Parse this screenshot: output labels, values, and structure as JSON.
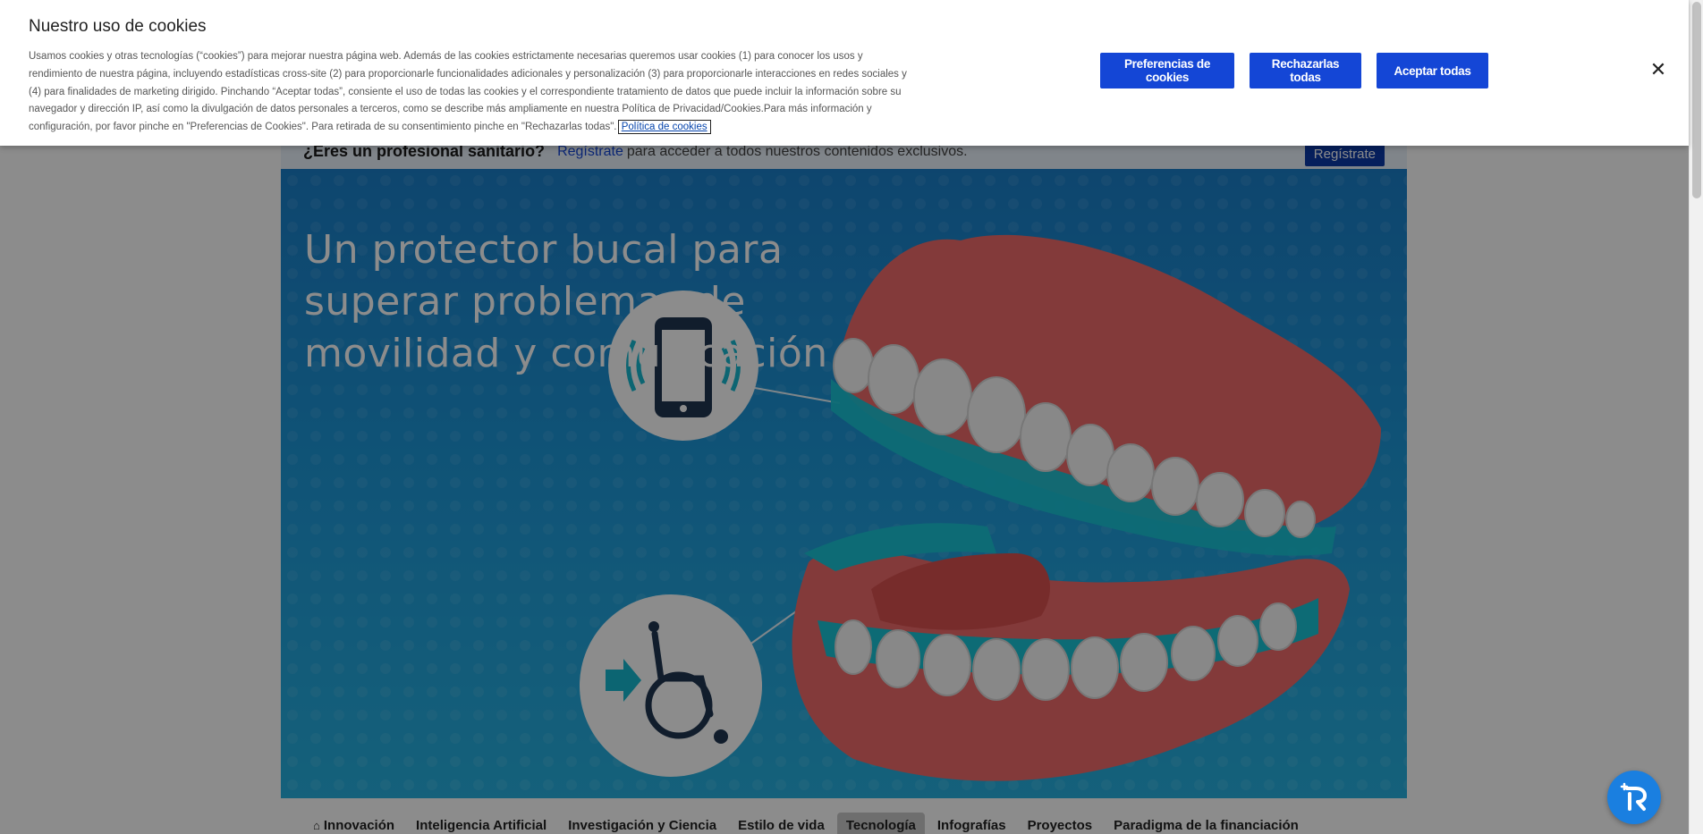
{
  "cookie_banner": {
    "title": "Nuestro uso de cookies",
    "text": "Usamos cookies y otras tecnologías (“cookies”) para mejorar nuestra página web. Además de las cookies estrictamente necesarias queremos usar cookies (1) para conocer los usos y rendimiento de nuestra página, incluyendo estadísticas cross-site (2) para proporcionarle funcionalidades adicionales y personalización (3) para proporcionarle interacciones en redes sociales y (4) para finalidades de marketing dirigido. Pinchando “Aceptar todas”, consiente el uso de todas las cookies y el correspondiente tratamiento de datos que puede incluir la información sobre su navegador y dirección IP, así como la divulgación de datos personales a terceros, como se describe más ampliamente en nuestra Política de Privacidad/Cookies.Para más información y configuración, por favor pinche en \"Preferencias de Cookies\". Para retirada de su consentimiento pinche en \"Rechazarlas todas\".",
    "policy_link": "Política de cookies",
    "buttons": {
      "preferences": "Preferencias de cookies",
      "reject": "Rechazarlas todas",
      "accept": "Aceptar todas"
    },
    "close_icon": "close-icon",
    "accent_color": "#1446d6"
  },
  "pro_banner": {
    "question": "¿Eres un profesional sanitario?",
    "link": "Regístrate",
    "rest": "para acceder a todos nuestros contenidos exclusivos.",
    "button": "Regístrate"
  },
  "hero": {
    "title": "Un protector bucal para superar problemas de movilidad y comunicación"
  },
  "category_nav": {
    "home_icon": "home-icon",
    "items": [
      {
        "label": "Innovación",
        "active": false
      },
      {
        "label": "Inteligencia Artificial",
        "active": false
      },
      {
        "label": "Investigación y Ciencia",
        "active": false
      },
      {
        "label": "Estilo de vida",
        "active": false
      },
      {
        "label": "Tecnología",
        "active": true
      },
      {
        "label": "Infografías",
        "active": false
      },
      {
        "label": "Proyectos",
        "active": false
      },
      {
        "label": "Paradigma de la financiación",
        "active": false
      }
    ]
  },
  "assistant": {
    "icon": "assistant-icon"
  }
}
